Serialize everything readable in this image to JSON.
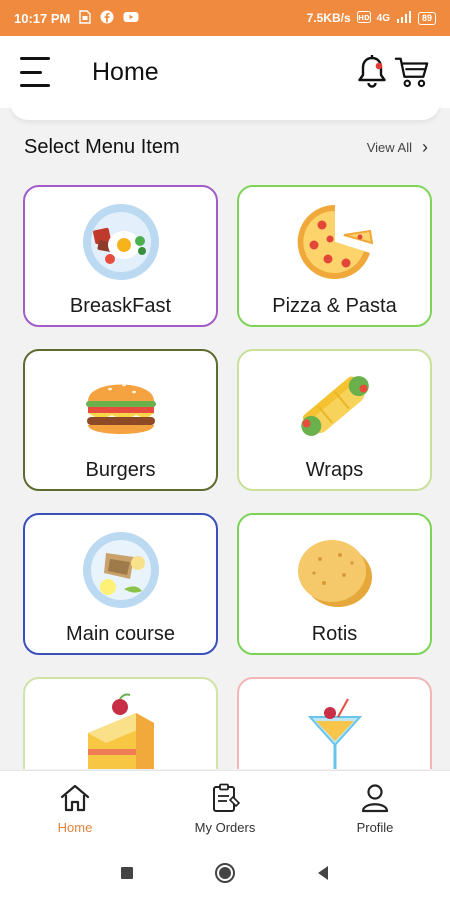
{
  "status_bar": {
    "time": "10:17 PM",
    "speed": "7.5KB/s",
    "network": "4G",
    "battery": "89"
  },
  "header": {
    "title": "Home"
  },
  "section": {
    "title": "Select Menu Item",
    "view_all": "View All"
  },
  "menu_items": [
    {
      "label": "BreaskFast",
      "icon": "breakfast-plate-icon",
      "border": "#a25bc9"
    },
    {
      "label": "Pizza & Pasta",
      "icon": "pizza-icon",
      "border": "#7fd35a"
    },
    {
      "label": "Burgers",
      "icon": "burger-icon",
      "border": "#5d6b2e"
    },
    {
      "label": "Wraps",
      "icon": "wrap-icon",
      "border": "#c9e09a"
    },
    {
      "label": "Main course",
      "icon": "main-course-plate-icon",
      "border": "#3a4fb8"
    },
    {
      "label": "Rotis",
      "icon": "roti-icon",
      "border": "#7ad357"
    },
    {
      "label": "",
      "icon": "cake-icon",
      "border": "#cfe3a6"
    },
    {
      "label": "",
      "icon": "cocktail-icon",
      "border": "#f3b6b6"
    }
  ],
  "bottom_nav": [
    {
      "label": "Home",
      "icon": "home-icon",
      "active": true
    },
    {
      "label": "My Orders",
      "icon": "orders-icon",
      "active": false
    },
    {
      "label": "Profile",
      "icon": "profile-icon",
      "active": false
    }
  ],
  "colors": {
    "accent": "#f08a3e",
    "active_nav": "#e2843e",
    "background": "#f2f2f2"
  }
}
